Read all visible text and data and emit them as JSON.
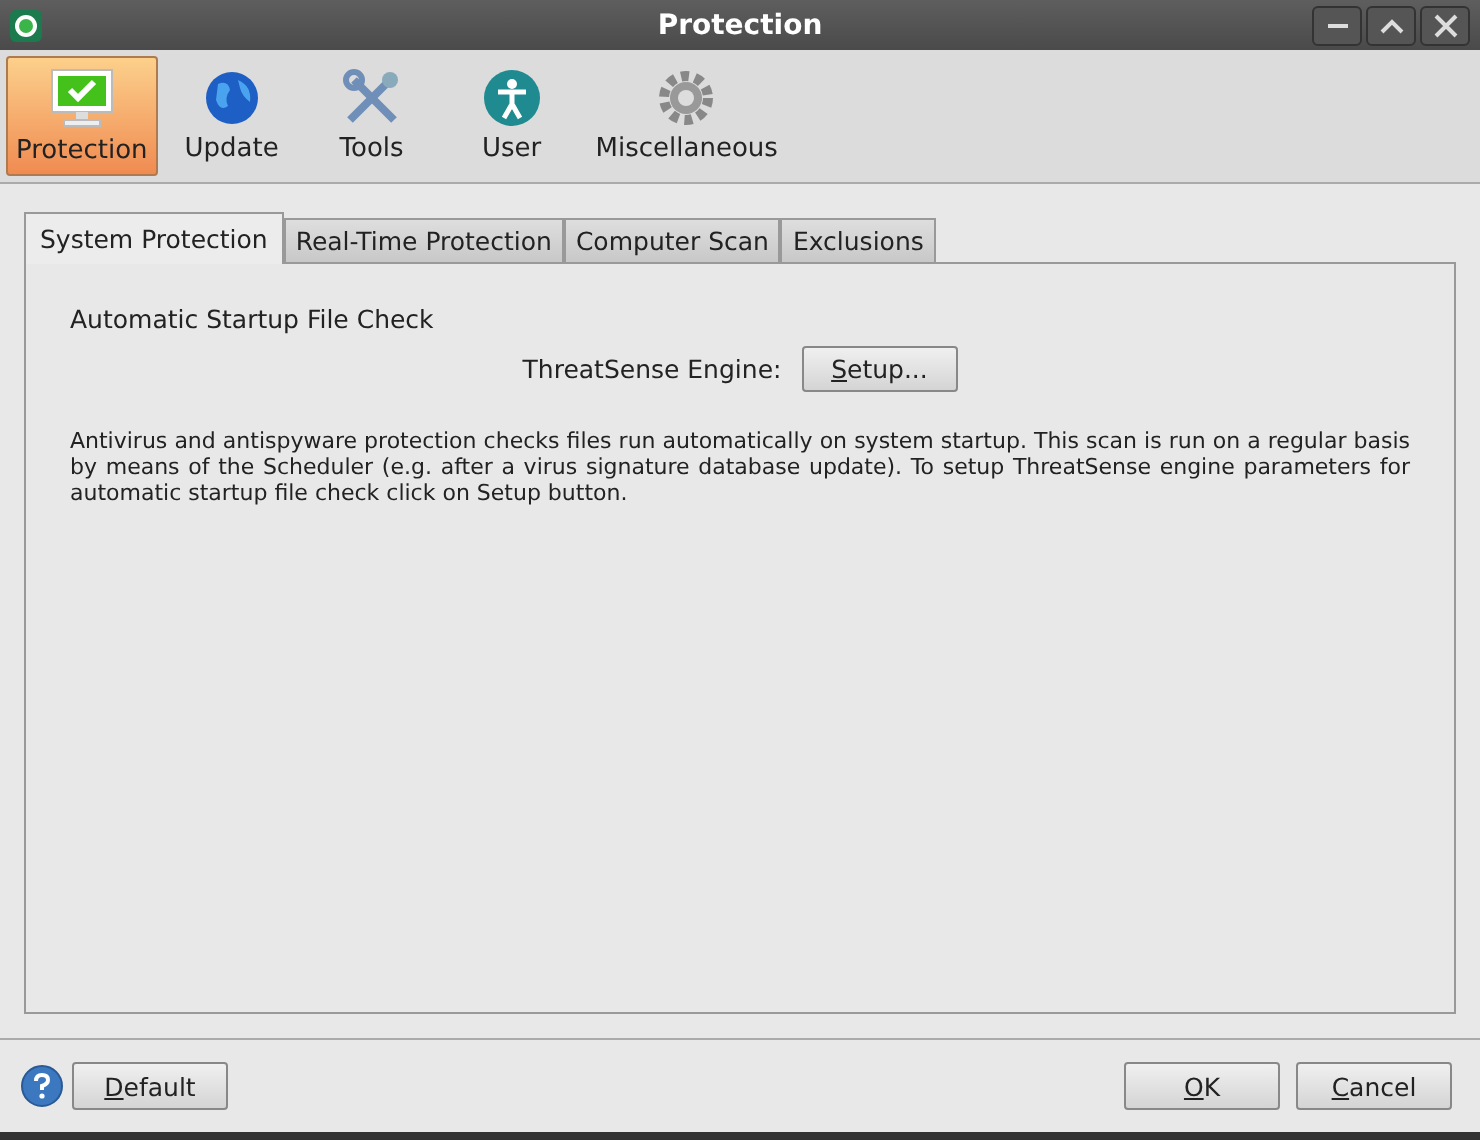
{
  "window": {
    "title": "Protection"
  },
  "toolbar": [
    {
      "label": "Protection",
      "selected": true
    },
    {
      "label": "Update",
      "selected": false
    },
    {
      "label": "Tools",
      "selected": false
    },
    {
      "label": "User",
      "selected": false
    },
    {
      "label": "Miscellaneous",
      "selected": false
    }
  ],
  "tabs": [
    {
      "label": "System Protection",
      "selected": true
    },
    {
      "label": "Real-Time Protection",
      "selected": false
    },
    {
      "label": "Computer Scan",
      "selected": false
    },
    {
      "label": "Exclusions",
      "selected": false
    }
  ],
  "section_title": "Automatic Startup File Check",
  "engine_label": "ThreatSense Engine:",
  "setup_button": {
    "label": "Setup...",
    "mnemonic": true
  },
  "description": "Antivirus and antispyware protection checks files run automatically on system startup. This scan is run on a regular basis by means of the Scheduler (e.g. after a virus signature database update). To setup ThreatSense engine parameters for automatic startup file check click on Setup button.",
  "footer": {
    "left_button": {
      "label": "Default",
      "mnemonic": true
    },
    "right_buttons": [
      {
        "label": "OK",
        "mnemonic": true
      },
      {
        "label": "Cancel",
        "mnemonic": true
      }
    ]
  }
}
